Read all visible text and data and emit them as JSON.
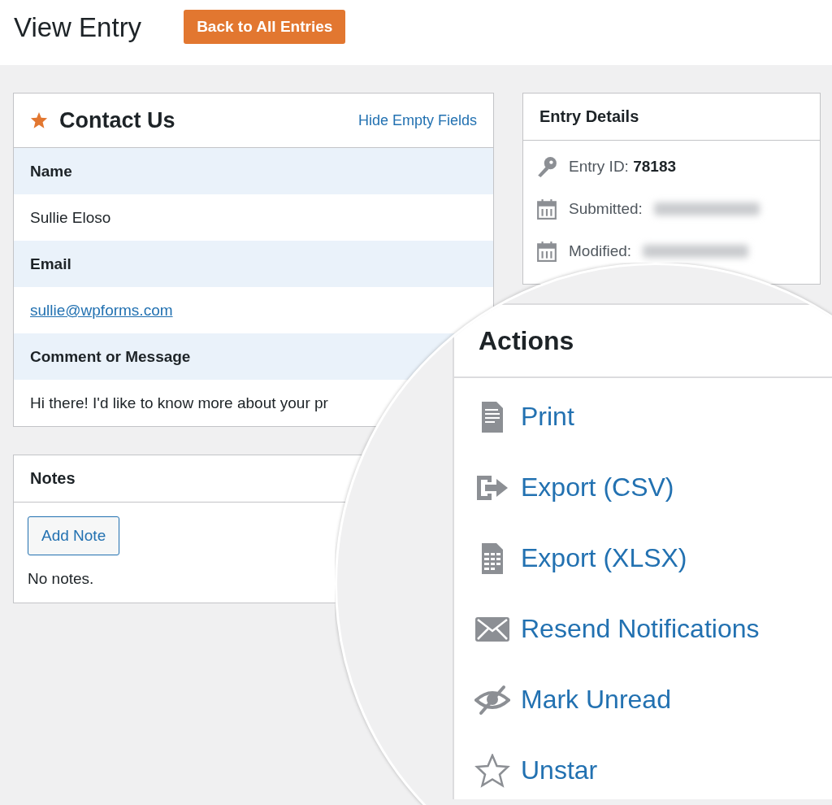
{
  "header": {
    "title": "View Entry",
    "back_button": "Back to All Entries"
  },
  "form_panel": {
    "title": "Contact Us",
    "hide_empty_link": "Hide Empty Fields",
    "fields": [
      {
        "label": "Name",
        "value": "Sullie Eloso",
        "kind": "text"
      },
      {
        "label": "Email",
        "value": "sullie@wpforms.com",
        "kind": "link"
      },
      {
        "label": "Comment or Message",
        "value": "Hi there! I'd like to know more about your pr",
        "kind": "text"
      }
    ]
  },
  "notes_panel": {
    "title": "Notes",
    "add_button": "Add Note",
    "empty_text": "No notes."
  },
  "entry_details": {
    "title": "Entry Details",
    "items": [
      {
        "label": "Entry ID:",
        "value": "78183",
        "kind": "id"
      },
      {
        "label": "Submitted:",
        "kind": "date"
      },
      {
        "label": "Modified:",
        "kind": "date"
      }
    ]
  },
  "actions_panel": {
    "title": "Actions",
    "items": [
      {
        "label": "Print",
        "kind": "print"
      },
      {
        "label": "Export (CSV)",
        "kind": "export"
      },
      {
        "label": "Export (XLSX)",
        "kind": "spreadsheet"
      },
      {
        "label": "Resend Notifications",
        "kind": "email"
      },
      {
        "label": "Mark Unread",
        "kind": "unread"
      },
      {
        "label": "Unstar",
        "kind": "unstar"
      }
    ]
  }
}
